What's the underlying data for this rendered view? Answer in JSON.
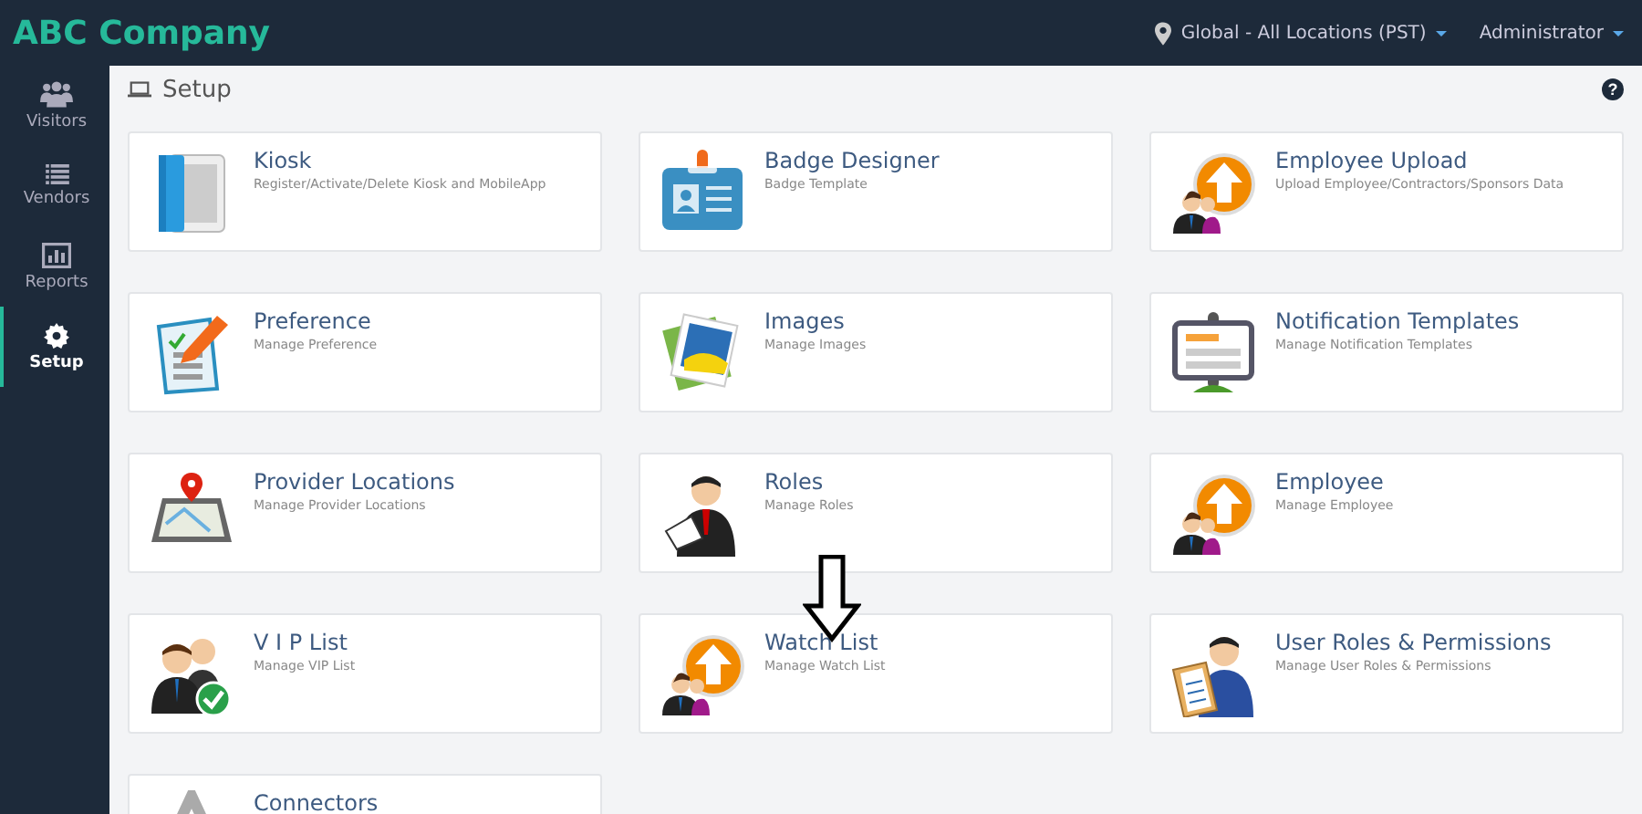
{
  "brand": "ABC Company",
  "top_menus": [
    {
      "kind": "location",
      "label": "Global - All Locations (PST)"
    },
    {
      "kind": "user",
      "label": "Administrator"
    }
  ],
  "sidebar": {
    "items": [
      {
        "kind": "people",
        "label": "Visitors",
        "selected": false
      },
      {
        "kind": "list",
        "label": "Vendors",
        "selected": false
      },
      {
        "kind": "chart",
        "label": "Reports",
        "selected": false
      },
      {
        "kind": "gear",
        "label": "Setup",
        "selected": true
      }
    ]
  },
  "page_title": "Setup",
  "help": "?",
  "cards": [
    {
      "kind": "tablet",
      "title": "Kiosk",
      "subtitle": "Register/Activate/Delete Kiosk and MobileApp"
    },
    {
      "kind": "badge",
      "title": "Badge Designer",
      "subtitle": "Badge Template"
    },
    {
      "kind": "upload",
      "title": "Employee Upload",
      "subtitle": "Upload Employee/Contractors/Sponsors Data"
    },
    {
      "kind": "form",
      "title": "Preference",
      "subtitle": "Manage Preference"
    },
    {
      "kind": "photos",
      "title": "Images",
      "subtitle": "Manage Images"
    },
    {
      "kind": "sign",
      "title": "Notification Templates",
      "subtitle": "Manage Notification Templates"
    },
    {
      "kind": "map",
      "title": "Provider Locations",
      "subtitle": "Manage Provider Locations"
    },
    {
      "kind": "person",
      "title": "Roles",
      "subtitle": "Manage Roles"
    },
    {
      "kind": "upload",
      "title": "Employee",
      "subtitle": "Manage Employee"
    },
    {
      "kind": "check",
      "title": "V I P List",
      "subtitle": "Manage VIP List"
    },
    {
      "kind": "upload",
      "title": "Watch List",
      "subtitle": "Manage Watch List"
    },
    {
      "kind": "clipboard",
      "title": "User Roles & Permissions",
      "subtitle": "Manage User Roles & Permissions"
    },
    {
      "kind": "plug",
      "title": "Connectors"
    }
  ]
}
